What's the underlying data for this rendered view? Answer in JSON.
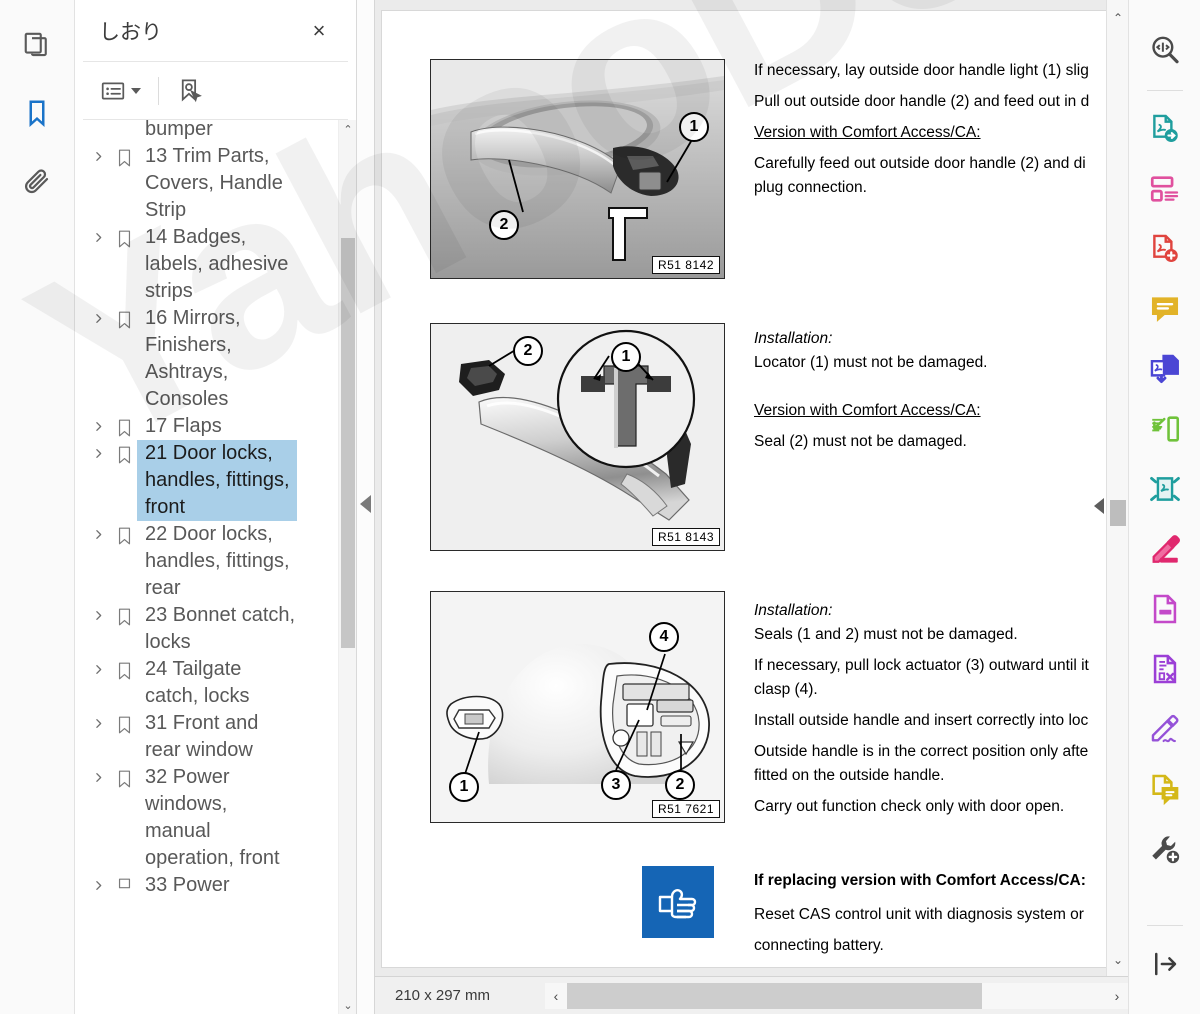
{
  "watermark": {
    "text": "YahooDownqwz"
  },
  "left_rail": {
    "items": [
      {
        "name": "page-thumbnails-icon",
        "label": "Page thumbnails",
        "active": false
      },
      {
        "name": "bookmarks-icon",
        "label": "Bookmarks",
        "active": true
      },
      {
        "name": "attachments-icon",
        "label": "Attachments",
        "active": false
      }
    ]
  },
  "bookmark_panel": {
    "title": "しおり",
    "close_label": "×",
    "toolbar": {
      "options_label": "Options",
      "new_bookmark_label": "New bookmark"
    },
    "items": [
      {
        "label": "bumper",
        "partial": true,
        "selected": false,
        "has_children": false
      },
      {
        "label": "13 Trim Parts, Covers, Handle Strip",
        "selected": false,
        "has_children": true
      },
      {
        "label": "14 Badges, labels, adhesive strips",
        "selected": false,
        "has_children": true
      },
      {
        "label": "16 Mirrors, Finishers, Ashtrays, Consoles",
        "selected": false,
        "has_children": true
      },
      {
        "label": "17 Flaps",
        "selected": false,
        "has_children": true
      },
      {
        "label": "21 Door locks, handles, fittings, front",
        "selected": true,
        "has_children": true
      },
      {
        "label": "22 Door locks, handles, fittings, rear",
        "selected": false,
        "has_children": true
      },
      {
        "label": "23 Bonnet catch, locks",
        "selected": false,
        "has_children": true
      },
      {
        "label": "24 Tailgate catch, locks",
        "selected": false,
        "has_children": true
      },
      {
        "label": "31 Front and rear window",
        "selected": false,
        "has_children": true
      },
      {
        "label": "32 Power windows, manual operation, front",
        "selected": false,
        "has_children": true
      },
      {
        "label": "33 Power",
        "partial": true,
        "selected": false,
        "has_children": true
      }
    ],
    "scroll_up": "⌃",
    "scroll_down": "⌄"
  },
  "document": {
    "figures": [
      {
        "code": "R51 8142",
        "type": "photo",
        "callouts": [
          "1",
          "2"
        ],
        "caption_alt": "Outside door handle with light and plug connection"
      },
      {
        "code": "R51 8143",
        "type": "photo",
        "callouts": [
          "1",
          "2"
        ],
        "caption_alt": "Detached outside door handle with locator detail"
      },
      {
        "code": "R51 7621",
        "type": "drawing",
        "callouts": [
          "1",
          "2",
          "3",
          "4"
        ],
        "caption_alt": "Door with seals, lock actuator and clasp"
      }
    ],
    "text_blocks": [
      {
        "id": "block-1",
        "lines": [
          {
            "text": "If necessary, lay outside door handle light (1) slig",
            "style": "normal",
            "clipped": true
          },
          {
            "text": "Pull out outside door handle (2) and feed out in d",
            "style": "normal",
            "clipped": true
          },
          {
            "text": "Version with Comfort Access/CA:",
            "style": "underline"
          },
          {
            "text": "Carefully feed out outside door handle (2) and di",
            "style": "normal",
            "clipped": true
          },
          {
            "text": "plug connection.",
            "style": "normal"
          }
        ]
      },
      {
        "id": "block-2",
        "lines": [
          {
            "text": "Installation:",
            "style": "italic"
          },
          {
            "text": "Locator (1) must not be damaged.",
            "style": "normal"
          },
          {
            "text": "",
            "style": "spacer"
          },
          {
            "text": "Version with Comfort Access/CA:",
            "style": "underline"
          },
          {
            "text": "Seal (2) must not be damaged.",
            "style": "normal"
          }
        ]
      },
      {
        "id": "block-3",
        "lines": [
          {
            "text": "Installation:",
            "style": "italic"
          },
          {
            "text": "Seals (1 and 2) must not be damaged.",
            "style": "normal"
          },
          {
            "text": "If necessary, pull lock actuator (3) outward until it",
            "style": "normal",
            "clipped": true
          },
          {
            "text": "clasp (4).",
            "style": "normal"
          },
          {
            "text": "Install outside handle and insert correctly into loc",
            "style": "normal",
            "clipped": true
          },
          {
            "text": "Outside handle is in the correct position only afte",
            "style": "normal",
            "clipped": true
          },
          {
            "text": "fitted on the outside handle.",
            "style": "normal"
          },
          {
            "text": "Carry out function check only with door open.",
            "style": "normal"
          }
        ]
      }
    ],
    "note": {
      "icon_name": "pointing-hand-icon",
      "icon_color": "#1565b5",
      "heading": "If replacing version with Comfort Access/CA:",
      "body_lines": [
        "Reset CAS control unit with diagnosis system or",
        "connecting battery."
      ]
    }
  },
  "status_bar": {
    "page_size": "210 x 297 mm",
    "scroll_left": "‹",
    "scroll_right": "›"
  },
  "right_toolbar": {
    "items": [
      {
        "name": "search-compare-icon",
        "label": "Search / Compare",
        "color": "#4a4a4a"
      },
      {
        "name": "export-pdf-icon",
        "label": "Export PDF",
        "color": "#1f9e9e"
      },
      {
        "name": "organize-pages-icon",
        "label": "Organize Pages",
        "color": "#e0509e"
      },
      {
        "name": "create-pdf-icon",
        "label": "Create PDF",
        "color": "#e0443e"
      },
      {
        "name": "comment-icon",
        "label": "Comment",
        "color": "#e2b328"
      },
      {
        "name": "import-pdf-icon",
        "label": "Import PDF",
        "color": "#4b46d4"
      },
      {
        "name": "page-extract-icon",
        "label": "Extract Pages",
        "color": "#6fc23a"
      },
      {
        "name": "compress-pdf-icon",
        "label": "Compress PDF",
        "color": "#1f9e9e"
      },
      {
        "name": "highlight-icon",
        "label": "Highlight",
        "color": "#e0286e"
      },
      {
        "name": "redact-icon",
        "label": "Redact",
        "color": "#c349c9"
      },
      {
        "name": "remove-content-icon",
        "label": "Remove Hidden Information",
        "color": "#9b3fd6"
      },
      {
        "name": "fill-and-sign-icon",
        "label": "Fill & Sign",
        "color": "#9552d8"
      },
      {
        "name": "doc-comment-icon",
        "label": "Document Comments",
        "color": "#d4b818"
      },
      {
        "name": "more-tools-icon",
        "label": "More Tools",
        "color": "#4a4a4a"
      }
    ],
    "collapse": {
      "name": "collapse-panel-icon",
      "label": "Collapse toolbar"
    }
  }
}
